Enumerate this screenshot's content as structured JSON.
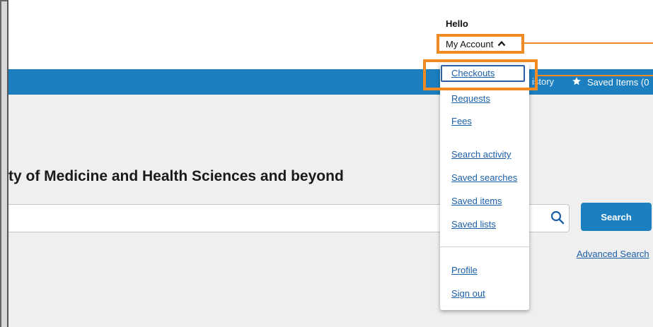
{
  "header": {
    "greeting": "Hello",
    "account_label": "My Account",
    "account_chevron": "^"
  },
  "nav": {
    "history_label": "istory",
    "saved_items_label": "Saved Items (0"
  },
  "main": {
    "headline": "ty of Medicine and Health Sciences and beyond",
    "search_input_value": "",
    "search_button_label": "Search",
    "advanced_search_label": "Advanced Search"
  },
  "account_menu": {
    "items": [
      {
        "label": "Checkouts"
      },
      {
        "label": "Requests"
      },
      {
        "label": "Fees"
      },
      {
        "label": "Search activity"
      },
      {
        "label": "Saved searches"
      },
      {
        "label": "Saved items"
      },
      {
        "label": "Saved lists"
      },
      {
        "label": "Profile"
      },
      {
        "label": "Sign out"
      }
    ]
  },
  "colors": {
    "accent_blue": "#1b7fc0",
    "highlight_orange": "#f08a24",
    "link_blue": "#1b5fa8"
  },
  "icons": {
    "search": "search-icon",
    "star": "star-icon",
    "chevron": "chevron-up-icon"
  }
}
